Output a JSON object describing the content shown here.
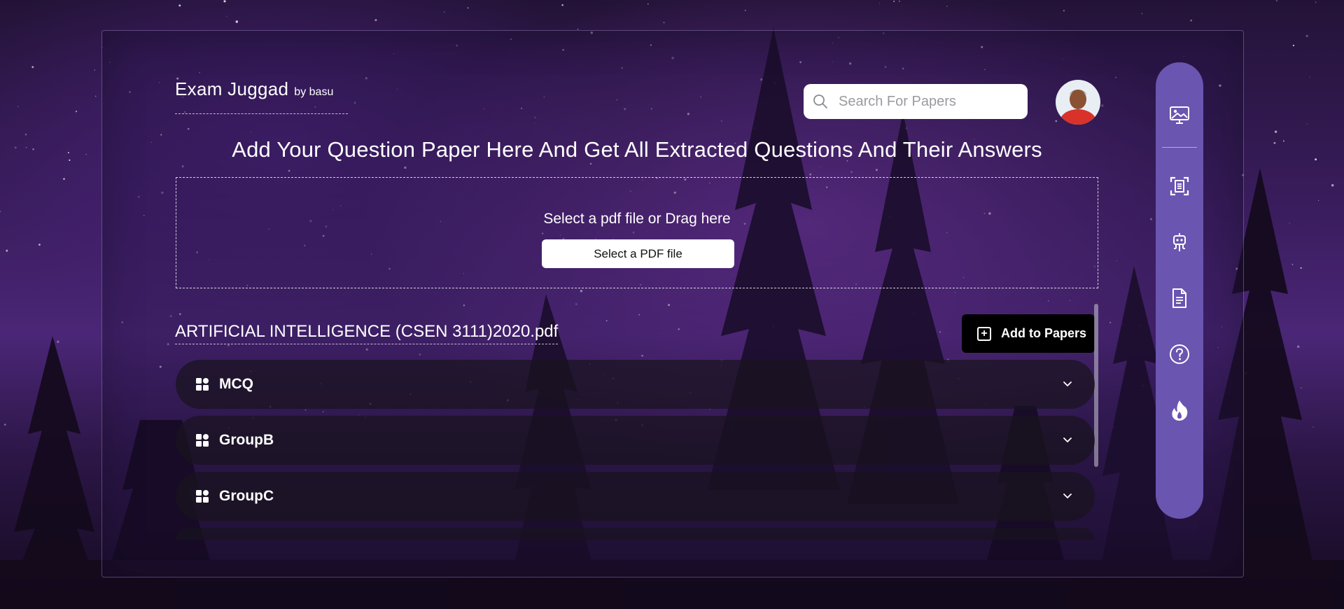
{
  "brand": {
    "title": "Exam Juggad",
    "byline": "by basu"
  },
  "search": {
    "placeholder": "Search For Papers",
    "value": ""
  },
  "headline": "Add Your Question Paper Here And Get All Extracted Questions And Their Answers",
  "upload": {
    "prompt": "Select a pdf file or Drag here",
    "button_label": "Select a PDF file"
  },
  "paper": {
    "filename": "ARTIFICIAL INTELLIGENCE (CSEN 3111)2020.pdf",
    "add_button_label": "Add to Papers",
    "groups": [
      {
        "label": "MCQ"
      },
      {
        "label": "GroupB"
      },
      {
        "label": "GroupC"
      }
    ]
  },
  "sidebar": {
    "items": [
      {
        "icon": "image-monitor-icon"
      },
      {
        "icon": "scan-document-icon"
      },
      {
        "icon": "robot-icon"
      },
      {
        "icon": "document-icon"
      },
      {
        "icon": "help-icon"
      },
      {
        "icon": "fire-icon"
      }
    ]
  },
  "colors": {
    "sidebar": "#6a55b0",
    "panel_border": "#bea9e6",
    "group_bg": "#19141e",
    "button_dark": "#000000"
  }
}
